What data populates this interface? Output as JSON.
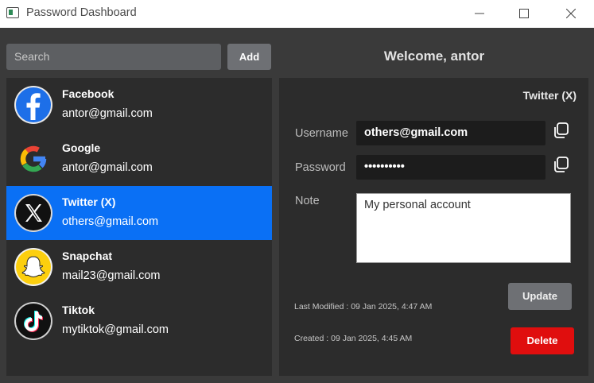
{
  "window": {
    "title": "Password Dashboard"
  },
  "search": {
    "placeholder": "Search"
  },
  "toolbar": {
    "add_label": "Add"
  },
  "header": {
    "welcome": "Welcome, antor"
  },
  "accounts": [
    {
      "name": "Facebook",
      "email": "antor@gmail.com",
      "icon": "facebook-icon",
      "selected": false
    },
    {
      "name": "Google",
      "email": "antor@gmail.com",
      "icon": "google-icon",
      "selected": false
    },
    {
      "name": "Twitter (X)",
      "email": "others@gmail.com",
      "icon": "x-twitter-icon",
      "selected": true
    },
    {
      "name": "Snapchat",
      "email": "mail23@gmail.com",
      "icon": "snapchat-icon",
      "selected": false
    },
    {
      "name": "Tiktok",
      "email": "mytiktok@gmail.com",
      "icon": "tiktok-icon",
      "selected": false
    }
  ],
  "detail": {
    "title": "Twitter (X)",
    "username_label": "Username",
    "username_value": "others@gmail.com",
    "password_label": "Password",
    "password_value": "••••••••••",
    "note_label": "Note",
    "note_value": "My personal account",
    "last_modified": "Last Modified : 09 Jan 2025, 4:47 AM",
    "created": "Created : 09 Jan 2025, 4:45 AM",
    "update_label": "Update",
    "delete_label": "Delete"
  },
  "colors": {
    "selection": "#0a70f5",
    "delete": "#e00e0e",
    "panel": "#2c2c2c",
    "background": "#3a3a3a"
  }
}
